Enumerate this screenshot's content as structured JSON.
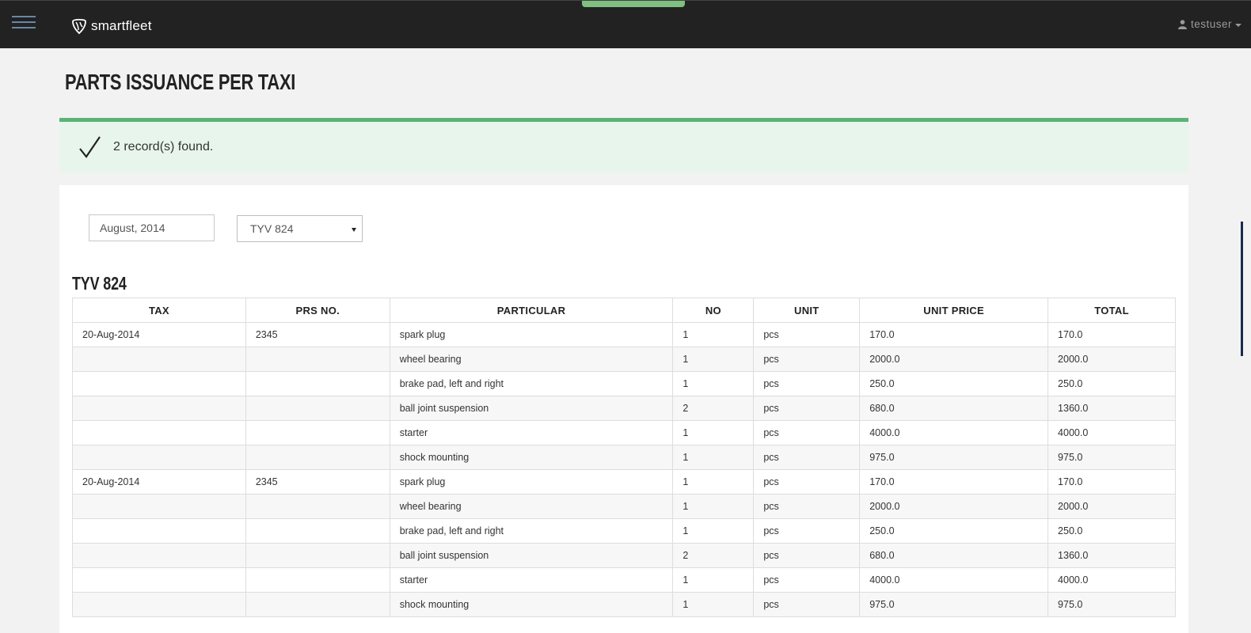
{
  "navbar": {
    "brand_light": "smart",
    "brand_bold": "fleet",
    "username": "testuser"
  },
  "page": {
    "title": "PARTS ISSUANCE PER TAXI"
  },
  "alert": {
    "message": "2 record(s) found.",
    "color": "#5cb377"
  },
  "filters": {
    "month_value": "August, 2014",
    "taxi_selected": "TYV 824"
  },
  "report": {
    "heading": "TYV 824",
    "columns": [
      "TAX",
      "PRS NO.",
      "PARTICULAR",
      "NO",
      "UNIT",
      "UNIT PRICE",
      "TOTAL"
    ],
    "rows": [
      [
        "20-Aug-2014",
        "2345",
        "spark plug",
        "1",
        "pcs",
        "170.0",
        "170.0"
      ],
      [
        "",
        "",
        "wheel bearing",
        "1",
        "pcs",
        "2000.0",
        "2000.0"
      ],
      [
        "",
        "",
        "brake pad, left and right",
        "1",
        "pcs",
        "250.0",
        "250.0"
      ],
      [
        "",
        "",
        "ball joint suspension",
        "2",
        "pcs",
        "680.0",
        "1360.0"
      ],
      [
        "",
        "",
        "starter",
        "1",
        "pcs",
        "4000.0",
        "4000.0"
      ],
      [
        "",
        "",
        "shock mounting",
        "1",
        "pcs",
        "975.0",
        "975.0"
      ],
      [
        "20-Aug-2014",
        "2345",
        "spark plug",
        "1",
        "pcs",
        "170.0",
        "170.0"
      ],
      [
        "",
        "",
        "wheel bearing",
        "1",
        "pcs",
        "2000.0",
        "2000.0"
      ],
      [
        "",
        "",
        "brake pad, left and right",
        "1",
        "pcs",
        "250.0",
        "250.0"
      ],
      [
        "",
        "",
        "ball joint suspension",
        "2",
        "pcs",
        "680.0",
        "1360.0"
      ],
      [
        "",
        "",
        "starter",
        "1",
        "pcs",
        "4000.0",
        "4000.0"
      ],
      [
        "",
        "",
        "shock mounting",
        "1",
        "pcs",
        "975.0",
        "975.0"
      ]
    ]
  },
  "icons": {
    "menu": "hamburger-menu-icon",
    "logo": "smartfleet-logo-icon",
    "user": "user-icon",
    "dropdown": "caret-down-icon",
    "success": "checkmark-icon"
  }
}
